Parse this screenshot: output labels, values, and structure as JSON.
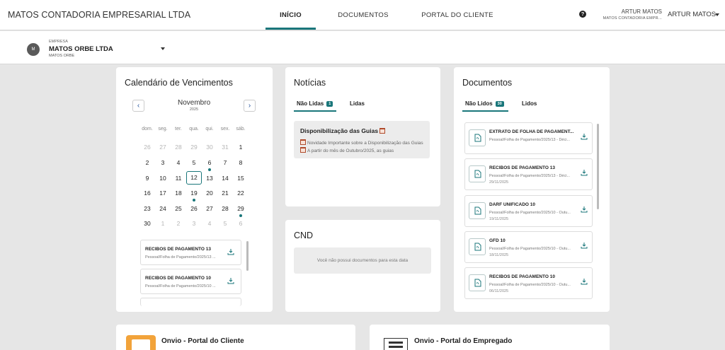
{
  "header": {
    "brand": "MATOS CONTADORIA EMPRESARIAL LTDA",
    "nav": [
      "INÍCIO",
      "DOCUMENTOS",
      "PORTAL DO CLIENTE"
    ],
    "help_label": "?",
    "user_name": "ARTUR MATOS",
    "user_company": "MATOS CONTADORIA EMPR...",
    "user_menu_label": "ARTUR MATOS"
  },
  "company": {
    "avatar": "M",
    "label": "EMPRESA",
    "name": "MATOS ORBE LTDA",
    "subname": "MATOS ORBE"
  },
  "calendar": {
    "title": "Calendário de Vencimentos",
    "month": "Novembro",
    "year": "2025",
    "prev": "‹",
    "next": "›",
    "weekdays": [
      "dom.",
      "seg.",
      "ter.",
      "qua.",
      "qui.",
      "sex.",
      "sáb."
    ],
    "weeks": [
      [
        "26",
        "27",
        "28",
        "29",
        "30",
        "31",
        "1"
      ],
      [
        "2",
        "3",
        "4",
        "5",
        "6",
        "7",
        "8"
      ],
      [
        "9",
        "10",
        "11",
        "12",
        "13",
        "14",
        "15"
      ],
      [
        "16",
        "17",
        "18",
        "19",
        "20",
        "21",
        "22"
      ],
      [
        "23",
        "24",
        "25",
        "26",
        "27",
        "28",
        "29"
      ],
      [
        "30",
        "1",
        "2",
        "3",
        "4",
        "5",
        "6"
      ]
    ],
    "today": "12",
    "event_days": [
      "6",
      "19",
      "29"
    ],
    "events": [
      {
        "title": "RECIBOS DE PAGAMENTO 13",
        "subtitle": "Pessoal/Folha de Pagamento/2025/13 ..."
      },
      {
        "title": "RECIBOS DE PAGAMENTO 10",
        "subtitle": "Pessoal/Folha de Pagamento/2025/10 ..."
      }
    ]
  },
  "news": {
    "title": "Notícias",
    "tabs": [
      {
        "label": "Não Lidas",
        "badge": "1"
      },
      {
        "label": "Lidas"
      }
    ],
    "item_title": "Disponibilização das Guias",
    "item_desc_1": "Novidade Importante sobre a Disponibilização das Guias",
    "item_desc_2": "A partir do mês de Outubro/2025, as guias"
  },
  "cnd": {
    "title": "CND",
    "empty": "Você não possui documentos para esta data"
  },
  "documents": {
    "title": "Documentos",
    "tabs": [
      {
        "label": "Não Lidos",
        "badge": "30"
      },
      {
        "label": "Lidos"
      }
    ],
    "items": [
      {
        "title": "EXTRATO DE FOLHA DE PAGAMENT...",
        "path": "Pessoal/Folha de Pagamento/2025/13 - Déci...",
        "date": ""
      },
      {
        "title": "RECIBOS DE PAGAMENTO 13",
        "path": "Pessoal/Folha de Pagamento/2025/13 - Déci...",
        "date": "29/11/2025"
      },
      {
        "title": "DARF UNIFICADO 10",
        "path": "Pessoal/Folha de Pagamento/2025/10 - Outu...",
        "date": "19/11/2025"
      },
      {
        "title": "GFD 10",
        "path": "Pessoal/Folha de Pagamento/2025/10 - Outu...",
        "date": "18/11/2025"
      },
      {
        "title": "RECIBOS DE PAGAMENTO 10",
        "path": "Pessoal/Folha de Pagamento/2025/10 - Outu...",
        "date": "06/11/2025"
      }
    ]
  },
  "portals": {
    "client": "Onvio - Portal do Cliente",
    "employee": "Onvio - Portal do Empregado"
  },
  "icons": {
    "help": "help-icon",
    "dropdown": "chevron-down-icon",
    "download": "download-icon",
    "pdf": "pdf-file-icon",
    "calendar_emoji": "calendar-icon"
  },
  "colors": {
    "accent": "#19767a",
    "event_dot": "#19767a"
  }
}
